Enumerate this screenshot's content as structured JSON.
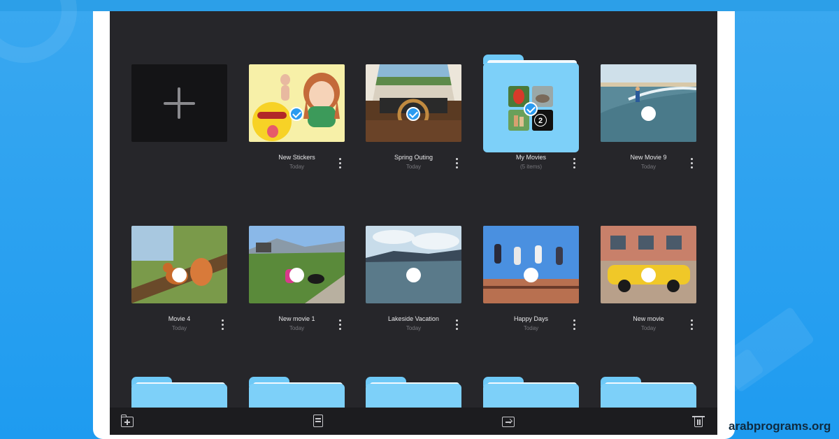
{
  "watermark": "arabprograms.org",
  "colors": {
    "screen_bg": "#26262a",
    "folder_blue": "#7dd0f9",
    "accent": "#2b9bf0"
  },
  "grid": {
    "new_tile": {
      "icon": "plus-icon"
    },
    "row1": [
      {
        "title": "New Stickers",
        "subtitle": "Today",
        "kind": "stickers",
        "selected": true
      },
      {
        "title": "Spring Outing",
        "subtitle": "Today",
        "kind": "photo",
        "selected": true
      },
      {
        "title": "My Movies",
        "subtitle": "(5 items)",
        "kind": "folder",
        "selected": true,
        "badge": "2"
      },
      {
        "title": "New Movie 9",
        "subtitle": "Today",
        "kind": "movie"
      }
    ],
    "row2": [
      {
        "title": "Movie 4",
        "subtitle": "Today"
      },
      {
        "title": "New movie 1",
        "subtitle": "Today"
      },
      {
        "title": "Lakeside Vacation",
        "subtitle": "Today"
      },
      {
        "title": "Happy Days",
        "subtitle": "Today"
      },
      {
        "title": "New movie",
        "subtitle": "Today"
      }
    ]
  },
  "toolbar": {
    "icons": [
      "new-folder-icon",
      "document-icon",
      "move-to-folder-icon",
      "trash-icon"
    ]
  }
}
